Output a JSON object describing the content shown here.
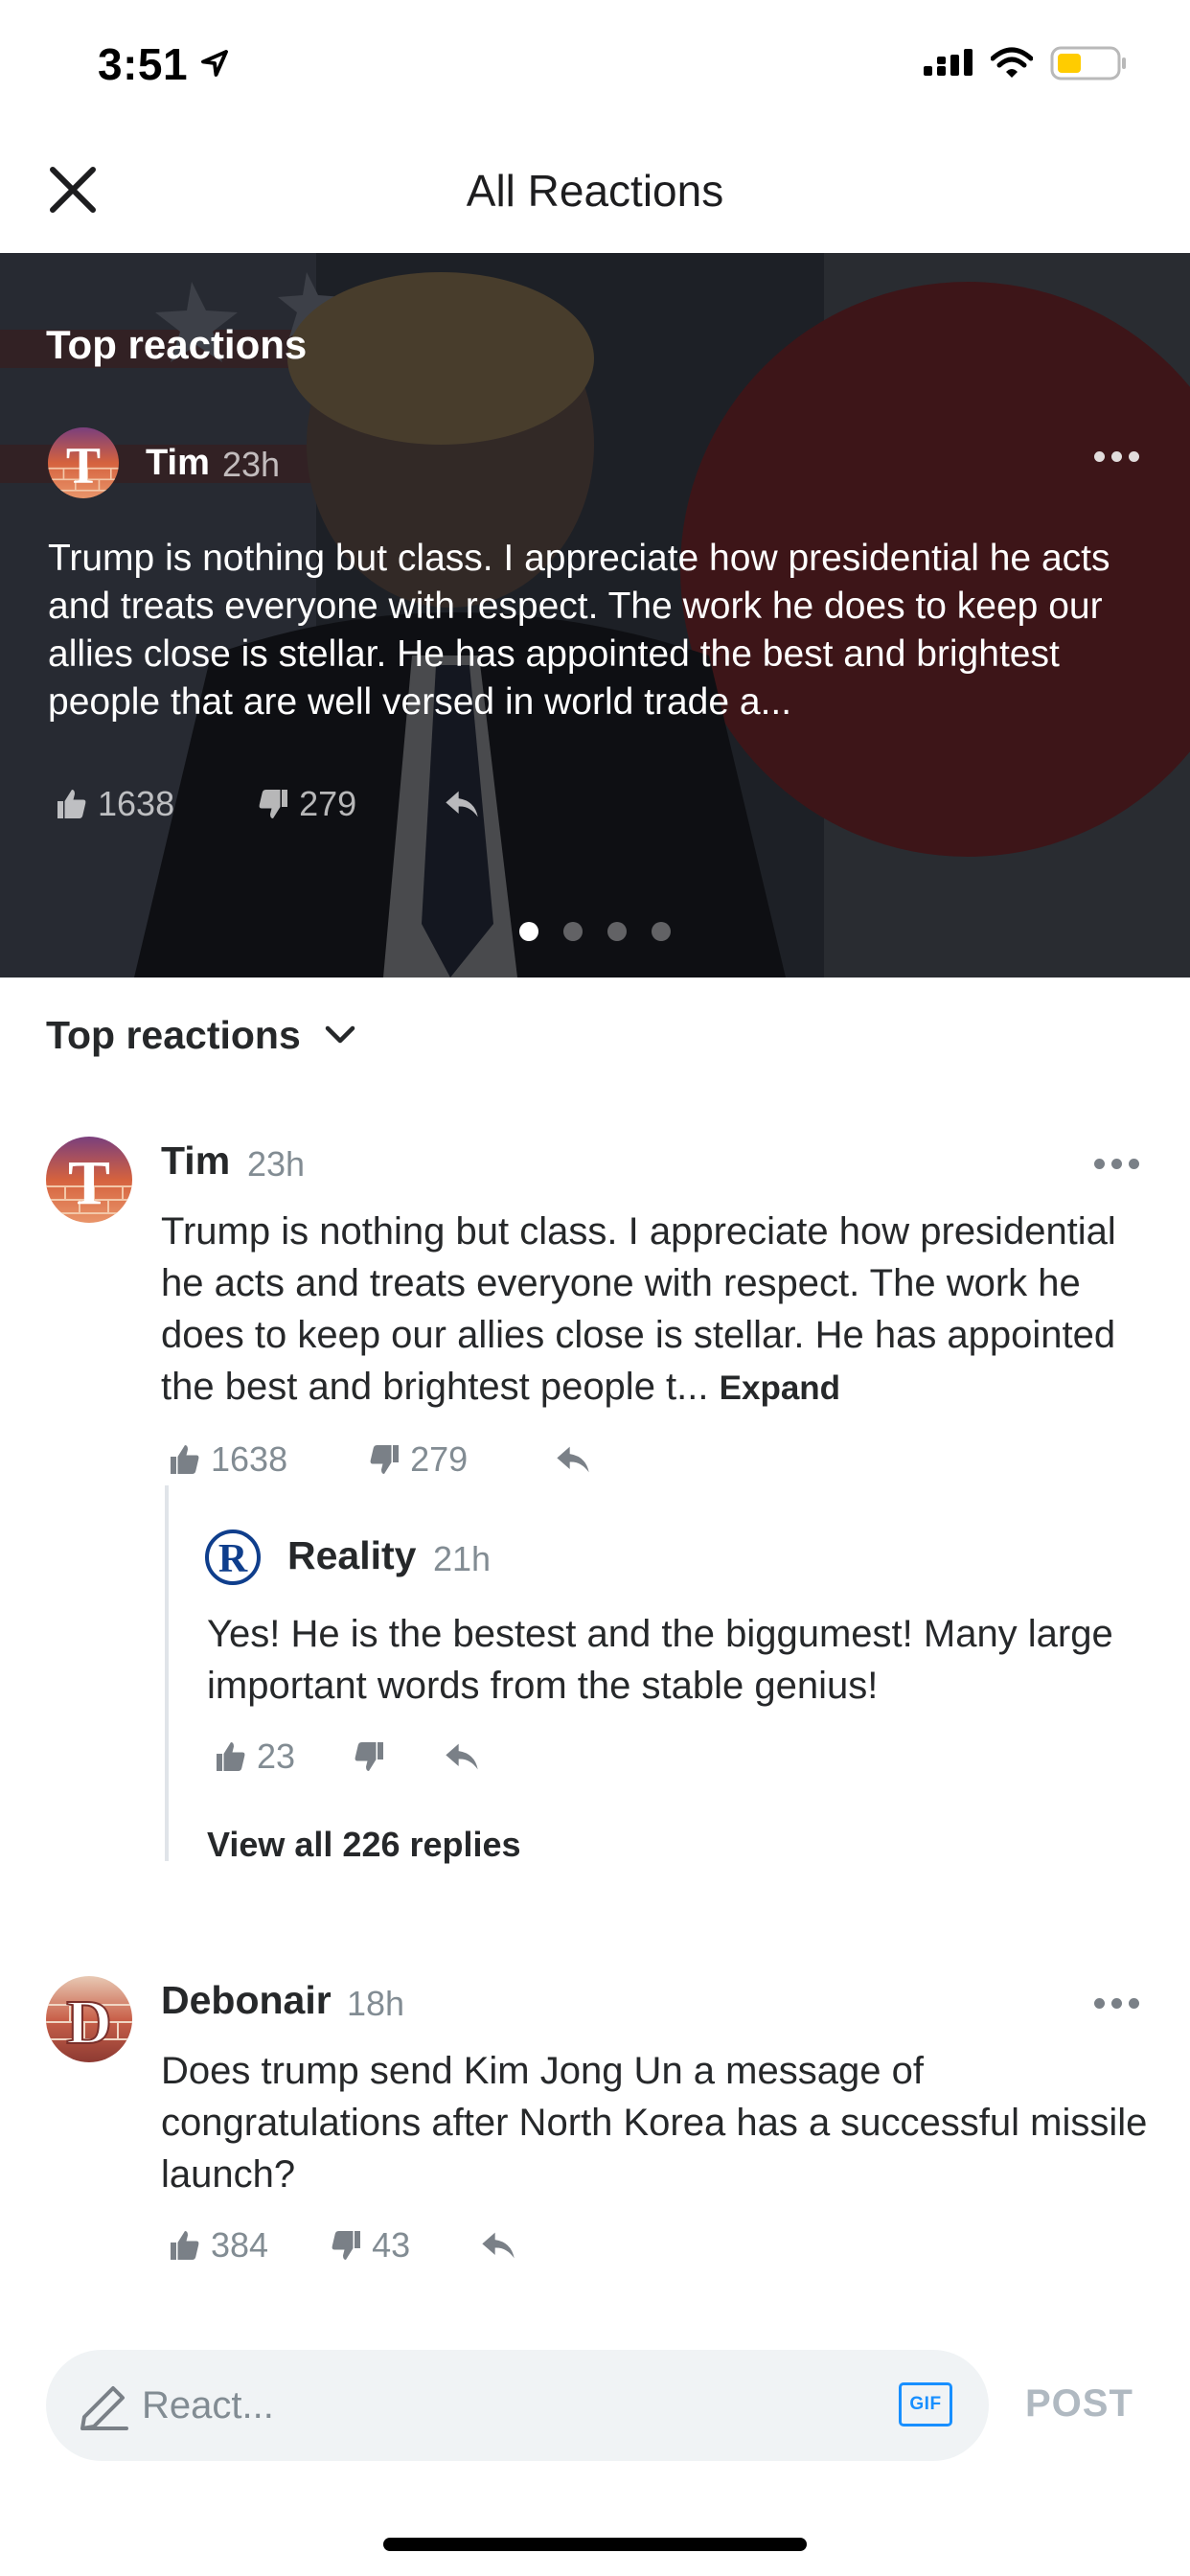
{
  "status_bar": {
    "time": "3:51"
  },
  "header": {
    "title": "All Reactions"
  },
  "hero": {
    "heading": "Top reactions",
    "author": "Tim",
    "time": "23h",
    "text": "Trump is nothing but class. I appreciate how presidential he acts and treats everyone with respect. The work he does to keep our allies close is stellar. He has appointed the best and brightest people that are well versed in world trade a...",
    "likes": "1638",
    "dislikes": "279",
    "pages": 4,
    "active_page": 1
  },
  "sort": {
    "label": "Top reactions"
  },
  "comments": [
    {
      "author": "Tim",
      "time": "23h",
      "text": "Trump is nothing but class. I appreciate how presidential he acts and treats everyone with respect. The work he does to keep our allies close is stellar. He has appointed the best and brightest people t...",
      "expand_label": "Expand",
      "likes": "1638",
      "dislikes": "279",
      "reply": {
        "author": "Reality",
        "time": "21h",
        "text": "Yes! He is the bestest and the biggumest! Many large important words from the stable genius!",
        "likes": "23"
      },
      "view_replies_label": "View all 226 replies"
    },
    {
      "author": "Debonair",
      "time": "18h",
      "text": "Does trump send Kim Jong Un a message of congratulations after North Korea has a successful missile launch?",
      "likes": "384",
      "dislikes": "43"
    }
  ],
  "composer": {
    "placeholder": "React...",
    "gif_label": "GIF",
    "post_label": "POST"
  },
  "colors": {
    "gif_blue": "#188fff",
    "muted_gray": "#828c93",
    "battery_yellow": "#ffcc00"
  },
  "icons": [
    "location-arrow-icon",
    "signal-icon",
    "wifi-icon",
    "battery-icon",
    "close-icon",
    "more-icon",
    "thumbs-up-icon",
    "thumbs-down-icon",
    "reply-icon",
    "chevron-down-icon",
    "pencil-icon"
  ]
}
